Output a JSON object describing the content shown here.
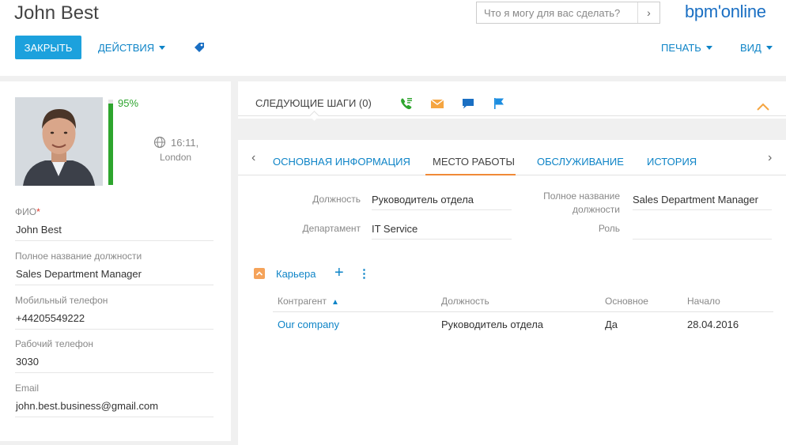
{
  "header": {
    "title": "John Best",
    "search_placeholder": "Что я могу для вас сделать?",
    "logo": "bpm'online",
    "close_label": "ЗАКРЫТЬ",
    "actions_label": "ДЕЙСТВИЯ",
    "print_label": "ПЕЧАТЬ",
    "view_label": "ВИД"
  },
  "profile": {
    "completeness_percent": 95,
    "completeness_label": "95%",
    "local_time": "16:11,",
    "city": "London",
    "fields": [
      {
        "label": "ФИО",
        "required_mark": "*",
        "value": "John Best"
      },
      {
        "label": "Полное название должности",
        "value": "Sales Department Manager"
      },
      {
        "label": "Мобильный телефон",
        "value": "+44205549222"
      },
      {
        "label": "Рабочий телефон",
        "value": "3030"
      },
      {
        "label": "Email",
        "value": "john.best.business@gmail.com"
      }
    ]
  },
  "next_steps": {
    "title": "СЛЕДУЮЩИЕ ШАГИ (0)",
    "icons": [
      "call-icon",
      "email-icon",
      "chat-icon",
      "flag-icon"
    ]
  },
  "tabs": {
    "items": [
      {
        "label": "ОСНОВНАЯ ИНФОРМАЦИЯ"
      },
      {
        "label": "МЕСТО РАБОТЫ"
      },
      {
        "label": "ОБСЛУЖИВАНИЕ"
      },
      {
        "label": "ИСТОРИЯ"
      }
    ],
    "active_index": 1
  },
  "job": {
    "position_label": "Должность",
    "position_value": "Руководитель отдела",
    "department_label": "Департамент",
    "department_value": "IT Service",
    "full_title_label_line1": "Полное название",
    "full_title_label_line2": "должности",
    "full_title_value": "Sales Department Manager",
    "role_label": "Роль",
    "role_value": ""
  },
  "career": {
    "title": "Карьера",
    "columns": [
      "Контрагент",
      "Должность",
      "Основное",
      "Начало"
    ],
    "rows": [
      {
        "account": "Our company",
        "position": "Руководитель отдела",
        "primary": "Да",
        "start": "28.04.2016"
      }
    ]
  },
  "colors": {
    "accent_blue": "#0e84c7",
    "close_button": "#1ca1dd",
    "progress_green": "#2ea52e",
    "tab_active_orange": "#f08a37",
    "required_red": "#e0392b"
  }
}
